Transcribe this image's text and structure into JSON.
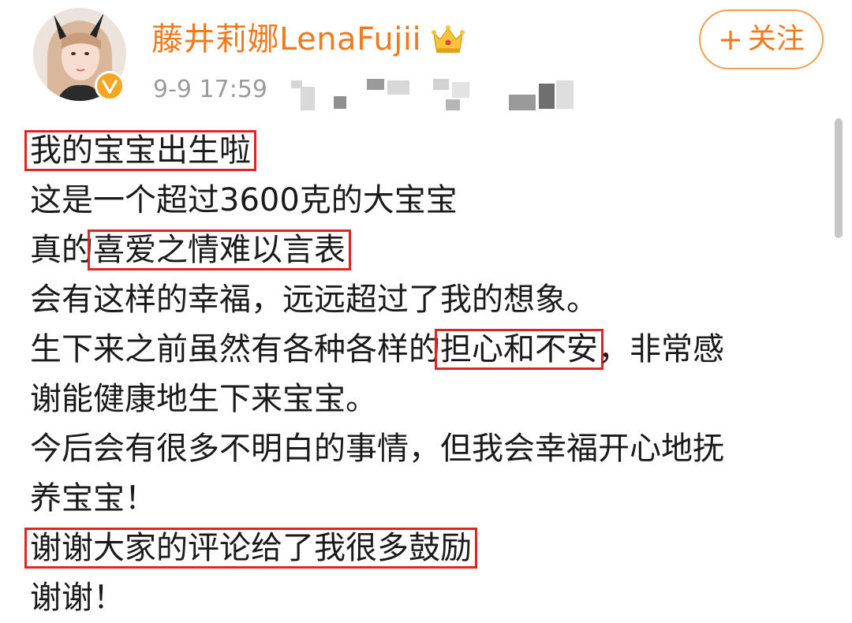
{
  "user": {
    "name": "藤井莉娜LenaFujii",
    "timestamp": "9-9 17:59"
  },
  "follow_button": {
    "plus": "+",
    "label": "关注"
  },
  "icons": {
    "avatar": "avatar-photo",
    "verified": "verified-badge-icon",
    "crown": "crown-icon"
  },
  "colors": {
    "username": "#f07a1d",
    "follow_border": "#f0a050",
    "highlight_box": "#e02424",
    "verified_badge": "#f5a623",
    "timestamp": "#9b9b9b"
  },
  "post": {
    "lines": [
      {
        "segments": [
          {
            "text": "我的宝宝出生啦",
            "highlight": true
          }
        ]
      },
      {
        "segments": [
          {
            "text": "这是一个超过3600克的大宝宝",
            "highlight": false
          }
        ]
      },
      {
        "segments": [
          {
            "text": "真的",
            "highlight": false
          },
          {
            "text": "喜爱之情难以言表",
            "highlight": true
          }
        ]
      },
      {
        "segments": [
          {
            "text": "会有这样的幸福，远远超过了我的想象。",
            "highlight": false
          }
        ]
      },
      {
        "segments": [
          {
            "text": "生下来之前虽然有各种各样的",
            "highlight": false
          },
          {
            "text": "担心和不安",
            "highlight": true
          },
          {
            "text": "，非常感",
            "highlight": false
          }
        ]
      },
      {
        "segments": [
          {
            "text": "谢能健康地生下来宝宝。",
            "highlight": false
          }
        ]
      },
      {
        "segments": [
          {
            "text": "今后会有很多不明白的事情，但我会幸福开心地抚",
            "highlight": false
          }
        ]
      },
      {
        "segments": [
          {
            "text": "养宝宝！",
            "highlight": false
          }
        ]
      },
      {
        "segments": [
          {
            "text": "谢谢大家的评论给了我很多鼓励",
            "highlight": true
          }
        ]
      },
      {
        "segments": [
          {
            "text": "谢谢！",
            "highlight": false
          }
        ]
      }
    ]
  }
}
